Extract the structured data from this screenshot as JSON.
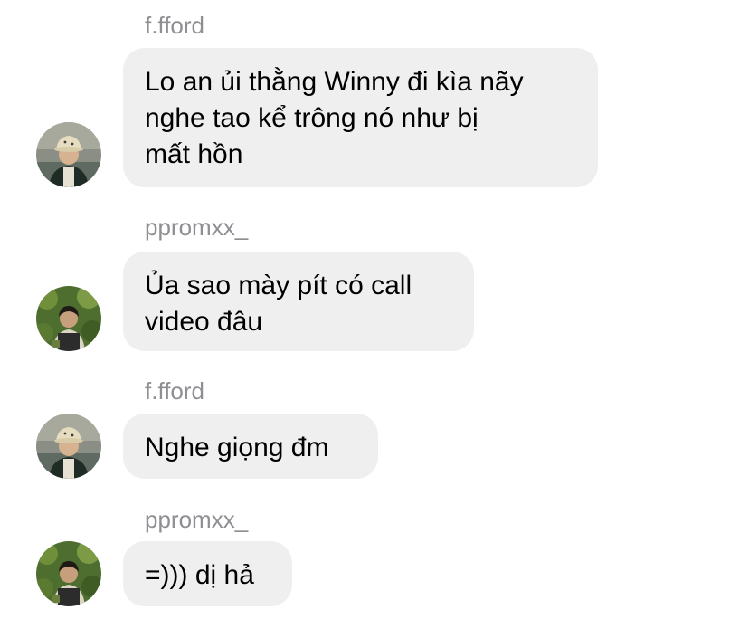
{
  "messages": [
    {
      "sender": "f.fford",
      "lines": [
        "Lo an ủi thằng Winny đi kìa nãy",
        "nghe tao kể trông nó như bị",
        "mất hồn"
      ]
    },
    {
      "sender": "ppromxx_",
      "lines": [
        "Ủa sao mày pít có call",
        "video đâu"
      ]
    },
    {
      "sender": "f.fford",
      "lines": [
        "Nghe giọng đm"
      ]
    },
    {
      "sender": "ppromxx_",
      "lines": [
        "=))) dị hả"
      ]
    }
  ],
  "avatars": {
    "f.fford": "profile-photo-person-in-bucket-hat",
    "ppromxx_": "profile-photo-person-in-greenery"
  },
  "colors": {
    "bubble_bg": "#efeff0",
    "sender_text": "#8e8e93",
    "message_text": "#000000"
  }
}
